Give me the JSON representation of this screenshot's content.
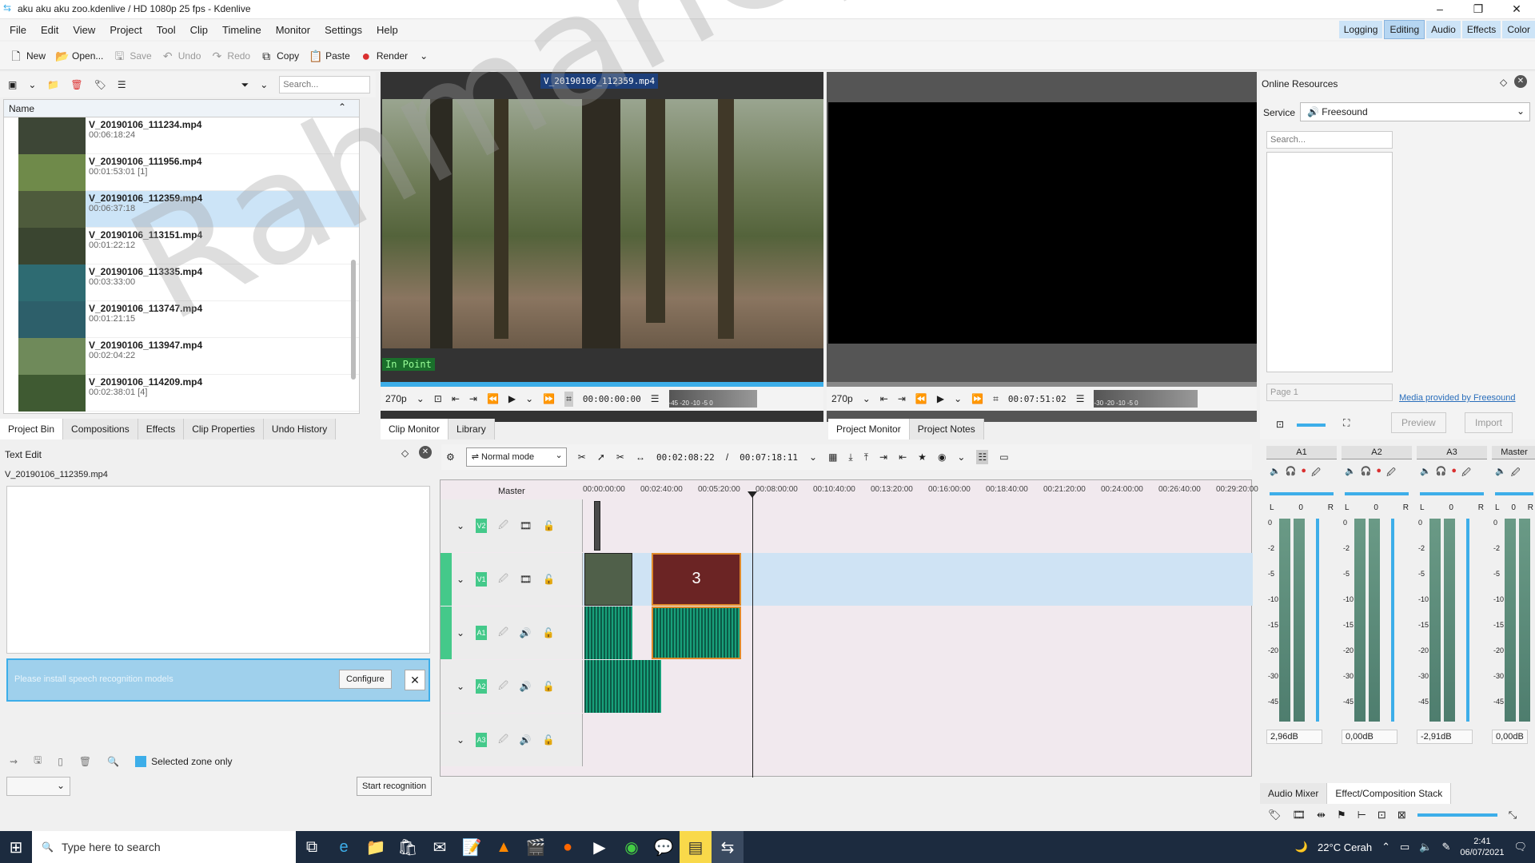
{
  "window": {
    "title": "aku aku aku zoo.kdenlive / HD 1080p 25 fps - Kdenlive",
    "min": "–",
    "max": "❐",
    "close": "✕"
  },
  "menu": [
    "File",
    "Edit",
    "View",
    "Project",
    "Tool",
    "Clip",
    "Timeline",
    "Monitor",
    "Settings",
    "Help"
  ],
  "layouts": [
    "Logging",
    "Editing",
    "Audio",
    "Effects",
    "Color"
  ],
  "toolbar": {
    "new": "New",
    "open": "Open...",
    "save": "Save",
    "undo": "Undo",
    "redo": "Redo",
    "copy": "Copy",
    "paste": "Paste",
    "render": "Render"
  },
  "bin": {
    "search_placeholder": "Search...",
    "column": "Name",
    "clips": [
      {
        "name": "V_20190106_111234.mp4",
        "dur": "00:06:18:24"
      },
      {
        "name": "V_20190106_111956.mp4",
        "dur": "00:01:53:01 [1]"
      },
      {
        "name": "V_20190106_112359.mp4",
        "dur": "00:06:37:18"
      },
      {
        "name": "V_20190106_113151.mp4",
        "dur": "00:01:22:12"
      },
      {
        "name": "V_20190106_113335.mp4",
        "dur": "00:03:33:00"
      },
      {
        "name": "V_20190106_113747.mp4",
        "dur": "00:01:21:15"
      },
      {
        "name": "V_20190106_113947.mp4",
        "dur": "00:02:04:22"
      },
      {
        "name": "V_20190106_114209.mp4",
        "dur": "00:02:38:01 [4]"
      }
    ],
    "tabs": [
      "Project Bin",
      "Compositions",
      "Effects",
      "Clip Properties",
      "Undo History"
    ]
  },
  "textedit": {
    "title": "Text Edit",
    "clip": "V_20190106_112359.mp4",
    "warning": "Please install speech recognition models",
    "configure": "Configure",
    "selected_zone": "Selected zone only",
    "start": "Start recognition"
  },
  "clipmon": {
    "label": "V_20190106_112359.mp4",
    "inpoint": "In Point",
    "zoom": "270p",
    "time": "00:00:00:00",
    "tabs": [
      "Clip Monitor",
      "Library"
    ],
    "scale": "-45 -20 -10 -5 0"
  },
  "projmon": {
    "zoom": "270p",
    "time": "00:07:51:02",
    "tabs": [
      "Project Monitor",
      "Project Notes"
    ],
    "scale": "-30 -20 -10 -5 0"
  },
  "online": {
    "title": "Online Resources",
    "service_label": "Service",
    "service": "Freesound",
    "search_placeholder": "Search...",
    "page": "Page 1",
    "link": "Media provided by Freesound",
    "preview": "Preview",
    "import": "Import"
  },
  "timeline": {
    "mode": "Normal mode",
    "pos": "00:02:08:22",
    "dur": "00:07:18:11",
    "master": "Master",
    "ruler": [
      "00:00:00:00",
      "00:02:40:00",
      "00:05:20:00",
      "00:08:00:00",
      "00:10:40:00",
      "00:13:20:00",
      "00:16:00:00",
      "00:18:40:00",
      "00:21:20:00",
      "00:24:00:00",
      "00:26:40:00",
      "00:29:20:00"
    ],
    "tracks": [
      "V2",
      "V1",
      "A1",
      "A2",
      "A3"
    ],
    "clip_number": "3"
  },
  "mixer": {
    "channels": [
      "A1",
      "A2",
      "A3",
      "Master"
    ],
    "pan": [
      "0",
      "0",
      "0",
      "0"
    ],
    "db": [
      "2,96dB",
      "0,00dB",
      "-2,91dB",
      "0,00dB"
    ],
    "L": "L",
    "R": "R",
    "scale": [
      "0",
      "-2",
      "-5",
      "-10",
      "-15",
      "-20",
      "-30",
      "-45"
    ],
    "tabs": [
      "Audio Mixer",
      "Effect/Composition Stack"
    ]
  },
  "taskbar": {
    "search": "Type here to search",
    "weather": "22°C  Cerah",
    "time": "2:41",
    "date": "06/07/2021"
  },
  "watermark": "RahmanCyber.NET",
  "colors": {
    "accent": "#3daee9",
    "selection": "#cce4f7",
    "track_chip": "#44c98a",
    "render": "#da3030"
  }
}
